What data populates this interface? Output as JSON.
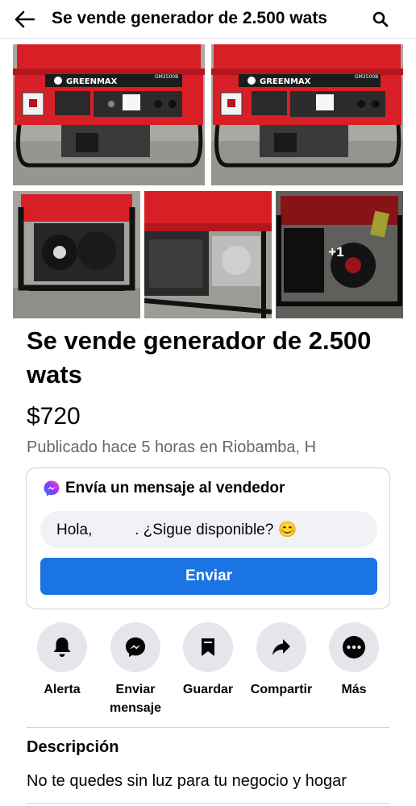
{
  "header": {
    "title": "Se vende generador de 2.500 wats",
    "back_icon": "arrow-left-icon",
    "search_icon": "search-icon"
  },
  "photos": {
    "more_count_label": "+1",
    "generator_brand": "GREENMAX",
    "generator_model": "GM2500B"
  },
  "listing": {
    "title": "Se vende generador de 2.500 wats",
    "price": "$720",
    "meta": "Publicado hace 5 horas en Riobamba, H"
  },
  "message": {
    "heading": "Envía un mensaje al vendedor",
    "input_value": "Hola,          . ¿Sigue disponible? 😊",
    "send_label": "Enviar"
  },
  "actions": [
    {
      "label": "Alerta",
      "icon": "bell-icon"
    },
    {
      "label": "Enviar mensaje",
      "icon": "messenger-icon"
    },
    {
      "label": "Guardar",
      "icon": "bookmark-icon"
    },
    {
      "label": "Compartir",
      "icon": "share-icon"
    },
    {
      "label": "Más",
      "icon": "more-icon"
    }
  ],
  "description": {
    "heading": "Descripción",
    "text": "No te quedes sin luz para tu negocio y hogar"
  },
  "colors": {
    "accent": "#1b74e4",
    "secondary_text": "#65676b",
    "button_bg": "#e4e6eb",
    "generator_red": "#d81f26"
  }
}
